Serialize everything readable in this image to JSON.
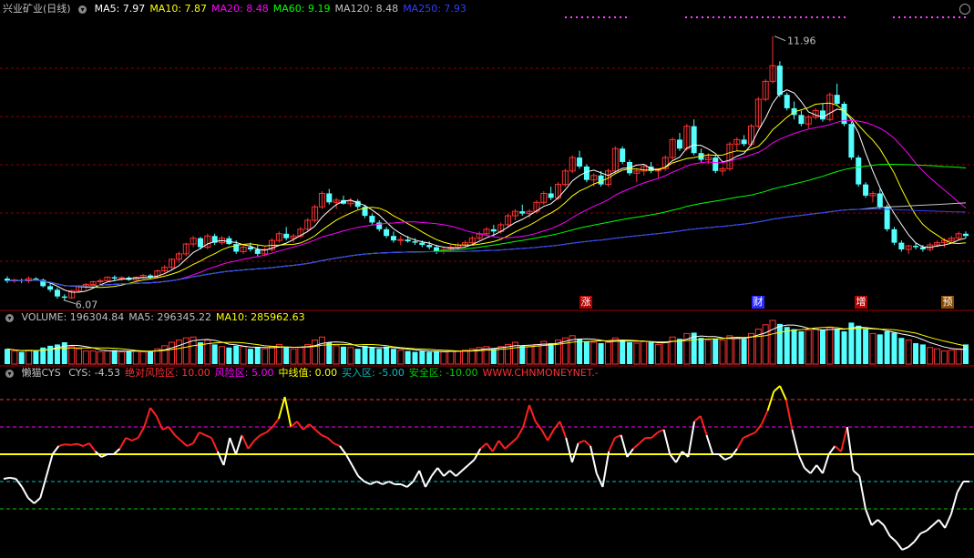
{
  "header": {
    "title": "兴业矿业(日线)",
    "ma_items": [
      {
        "label": "MA5: 7.97",
        "color": "#ffffff"
      },
      {
        "label": "MA10: 7.87",
        "color": "#ffff00"
      },
      {
        "label": "MA20: 8.48",
        "color": "#ff00ff"
      },
      {
        "label": "MA60: 9.19",
        "color": "#00ff00"
      },
      {
        "label": "MA120: 8.48",
        "color": "#c0c0c0"
      },
      {
        "label": "MA250: 7.93",
        "color": "#2f3fff"
      }
    ]
  },
  "volume_header": {
    "items": [
      {
        "label": "VOLUME: 196304.84",
        "color": "#c0c0c0"
      },
      {
        "label": "MA5: 296345.22",
        "color": "#c0c0c0"
      },
      {
        "label": "MA10: 285962.63",
        "color": "#ffff00"
      }
    ]
  },
  "cys_header": {
    "name": "懒猫CYS",
    "items": [
      {
        "label": "CYS: -4.53",
        "color": "#c0c0c0"
      },
      {
        "label": "绝对风险区: 10.00",
        "color": "#ff3030"
      },
      {
        "label": "风险区: 5.00",
        "color": "#ff00ff"
      },
      {
        "label": "中线值: 0.00",
        "color": "#ffff00"
      },
      {
        "label": "买入区: -5.00",
        "color": "#00c0c0"
      },
      {
        "label": "安全区: -10.00",
        "color": "#00cc00"
      },
      {
        "label": "WWW.CHNMONEYNET.-",
        "color": "#ff3030"
      }
    ]
  },
  "annotations": {
    "high_label": "11.96",
    "low_label": "6.07"
  },
  "events": [
    "涨",
    "财",
    "增",
    "预"
  ],
  "colors": {
    "up": "#ff3232",
    "down": "#54ffff",
    "bg": "#000000",
    "grid": "#8b0000"
  },
  "chart_data": [
    {
      "type": "candlestick",
      "title": "兴业矿业(日线)",
      "price_high": 11.96,
      "price_low": 6.07,
      "series_note": "daily OHLC (approximate, read from chart)",
      "candles": [
        [
          6.55,
          6.6,
          6.45,
          6.5
        ],
        [
          6.5,
          6.55,
          6.45,
          6.52
        ],
        [
          6.52,
          6.55,
          6.45,
          6.5
        ],
        [
          6.5,
          6.6,
          6.45,
          6.55
        ],
        [
          6.55,
          6.58,
          6.5,
          6.52
        ],
        [
          6.52,
          6.55,
          6.35,
          6.38
        ],
        [
          6.38,
          6.45,
          6.25,
          6.3
        ],
        [
          6.3,
          6.35,
          6.1,
          6.15
        ],
        [
          6.15,
          6.2,
          6.07,
          6.12
        ],
        [
          6.12,
          6.3,
          6.1,
          6.28
        ],
        [
          6.28,
          6.4,
          6.25,
          6.38
        ],
        [
          6.38,
          6.45,
          6.3,
          6.42
        ],
        [
          6.42,
          6.5,
          6.38,
          6.48
        ],
        [
          6.48,
          6.55,
          6.4,
          6.5
        ],
        [
          6.5,
          6.6,
          6.48,
          6.58
        ],
        [
          6.58,
          6.62,
          6.5,
          6.55
        ],
        [
          6.55,
          6.6,
          6.5,
          6.57
        ],
        [
          6.57,
          6.6,
          6.5,
          6.52
        ],
        [
          6.52,
          6.6,
          6.5,
          6.58
        ],
        [
          6.58,
          6.65,
          6.55,
          6.62
        ],
        [
          6.62,
          6.65,
          6.55,
          6.58
        ],
        [
          6.58,
          6.75,
          6.55,
          6.72
        ],
        [
          6.72,
          6.85,
          6.68,
          6.8
        ],
        [
          6.8,
          7.0,
          6.75,
          6.98
        ],
        [
          6.98,
          7.15,
          6.9,
          7.1
        ],
        [
          7.1,
          7.35,
          7.05,
          7.32
        ],
        [
          7.32,
          7.5,
          7.25,
          7.45
        ],
        [
          7.45,
          7.48,
          7.2,
          7.25
        ],
        [
          7.25,
          7.55,
          7.2,
          7.5
        ],
        [
          7.5,
          7.55,
          7.3,
          7.35
        ],
        [
          7.35,
          7.5,
          7.3,
          7.45
        ],
        [
          7.45,
          7.5,
          7.3,
          7.32
        ],
        [
          7.32,
          7.4,
          7.1,
          7.15
        ],
        [
          7.15,
          7.3,
          7.1,
          7.25
        ],
        [
          7.25,
          7.35,
          7.15,
          7.2
        ],
        [
          7.2,
          7.3,
          7.05,
          7.1
        ],
        [
          7.1,
          7.25,
          7.05,
          7.2
        ],
        [
          7.2,
          7.45,
          7.15,
          7.4
        ],
        [
          7.4,
          7.6,
          7.35,
          7.55
        ],
        [
          7.55,
          7.7,
          7.4,
          7.45
        ],
        [
          7.45,
          7.55,
          7.35,
          7.5
        ],
        [
          7.5,
          7.7,
          7.45,
          7.65
        ],
        [
          7.65,
          7.9,
          7.6,
          7.85
        ],
        [
          7.85,
          8.2,
          7.8,
          8.15
        ],
        [
          8.15,
          8.5,
          8.1,
          8.45
        ],
        [
          8.45,
          8.55,
          8.2,
          8.25
        ],
        [
          8.25,
          8.35,
          8.1,
          8.3
        ],
        [
          8.3,
          8.4,
          8.2,
          8.22
        ],
        [
          8.22,
          8.35,
          8.15,
          8.28
        ],
        [
          8.28,
          8.32,
          8.1,
          8.15
        ],
        [
          8.15,
          8.2,
          7.9,
          7.95
        ],
        [
          7.95,
          8.0,
          7.75,
          7.8
        ],
        [
          7.8,
          7.85,
          7.6,
          7.65
        ],
        [
          7.65,
          7.7,
          7.45,
          7.5
        ],
        [
          7.5,
          7.6,
          7.35,
          7.4
        ],
        [
          7.4,
          7.5,
          7.3,
          7.42
        ],
        [
          7.42,
          7.5,
          7.35,
          7.38
        ],
        [
          7.38,
          7.45,
          7.3,
          7.35
        ],
        [
          7.35,
          7.4,
          7.25,
          7.3
        ],
        [
          7.3,
          7.38,
          7.2,
          7.25
        ],
        [
          7.25,
          7.3,
          7.1,
          7.15
        ],
        [
          7.15,
          7.25,
          7.1,
          7.2
        ],
        [
          7.2,
          7.3,
          7.15,
          7.25
        ],
        [
          7.25,
          7.35,
          7.2,
          7.3
        ],
        [
          7.3,
          7.4,
          7.25,
          7.35
        ],
        [
          7.35,
          7.5,
          7.3,
          7.45
        ],
        [
          7.45,
          7.6,
          7.4,
          7.55
        ],
        [
          7.55,
          7.7,
          7.5,
          7.65
        ],
        [
          7.65,
          7.75,
          7.5,
          7.6
        ],
        [
          7.6,
          7.8,
          7.55,
          7.75
        ],
        [
          7.75,
          8.0,
          7.7,
          7.95
        ],
        [
          7.95,
          8.1,
          7.85,
          8.05
        ],
        [
          8.05,
          8.2,
          7.95,
          8.0
        ],
        [
          8.0,
          8.1,
          7.9,
          8.05
        ],
        [
          8.05,
          8.3,
          8.0,
          8.25
        ],
        [
          8.25,
          8.5,
          8.2,
          8.45
        ],
        [
          8.45,
          8.6,
          8.3,
          8.35
        ],
        [
          8.35,
          8.7,
          8.3,
          8.65
        ],
        [
          8.65,
          9.0,
          8.6,
          8.95
        ],
        [
          8.95,
          9.3,
          8.9,
          9.25
        ],
        [
          9.25,
          9.4,
          9.0,
          9.05
        ],
        [
          9.05,
          9.1,
          8.7,
          8.75
        ],
        [
          8.75,
          8.9,
          8.6,
          8.85
        ],
        [
          8.85,
          8.95,
          8.6,
          8.65
        ],
        [
          8.65,
          9.0,
          8.6,
          8.95
        ],
        [
          8.95,
          9.5,
          8.9,
          9.45
        ],
        [
          9.45,
          9.5,
          9.1,
          9.15
        ],
        [
          9.15,
          9.2,
          8.85,
          8.9
        ],
        [
          8.9,
          9.0,
          8.7,
          8.95
        ],
        [
          8.95,
          9.1,
          8.85,
          9.05
        ],
        [
          9.05,
          9.15,
          8.9,
          8.95
        ],
        [
          8.95,
          9.0,
          8.8,
          9.0
        ],
        [
          9.0,
          9.3,
          8.95,
          9.25
        ],
        [
          9.25,
          9.7,
          9.2,
          9.65
        ],
        [
          9.65,
          9.8,
          9.4,
          9.45
        ],
        [
          9.45,
          10.0,
          9.4,
          9.95
        ],
        [
          9.95,
          10.1,
          9.3,
          9.35
        ],
        [
          9.35,
          9.45,
          9.15,
          9.2
        ],
        [
          9.2,
          9.35,
          9.1,
          9.25
        ],
        [
          9.25,
          9.3,
          8.9,
          8.95
        ],
        [
          8.95,
          9.05,
          8.85,
          9.0
        ],
        [
          9.0,
          9.6,
          8.95,
          9.55
        ],
        [
          9.55,
          9.7,
          9.4,
          9.65
        ],
        [
          9.65,
          9.75,
          9.5,
          9.55
        ],
        [
          9.55,
          10.0,
          9.5,
          9.95
        ],
        [
          9.95,
          10.6,
          9.9,
          10.55
        ],
        [
          10.55,
          11.0,
          10.5,
          10.95
        ],
        [
          10.95,
          11.96,
          10.9,
          11.3
        ],
        [
          11.3,
          11.4,
          10.6,
          10.65
        ],
        [
          10.65,
          10.7,
          10.3,
          10.35
        ],
        [
          10.35,
          10.5,
          10.1,
          10.2
        ],
        [
          10.2,
          10.3,
          9.95,
          10.0
        ],
        [
          10.0,
          10.2,
          9.9,
          10.15
        ],
        [
          10.15,
          10.35,
          10.1,
          10.3
        ],
        [
          10.3,
          10.45,
          10.05,
          10.1
        ],
        [
          10.1,
          10.7,
          10.05,
          10.65
        ],
        [
          10.65,
          10.9,
          10.4,
          10.45
        ],
        [
          10.45,
          10.5,
          9.95,
          10.0
        ],
        [
          10.0,
          10.05,
          9.2,
          9.25
        ],
        [
          9.25,
          9.3,
          8.6,
          8.65
        ],
        [
          8.65,
          8.7,
          8.35,
          8.4
        ],
        [
          8.4,
          8.5,
          8.25,
          8.45
        ],
        [
          8.45,
          8.55,
          8.1,
          8.15
        ],
        [
          8.15,
          8.2,
          7.6,
          7.65
        ],
        [
          7.65,
          7.7,
          7.3,
          7.35
        ],
        [
          7.35,
          7.4,
          7.15,
          7.2
        ],
        [
          7.2,
          7.3,
          7.1,
          7.28
        ],
        [
          7.28,
          7.35,
          7.2,
          7.25
        ],
        [
          7.25,
          7.3,
          7.15,
          7.2
        ],
        [
          7.2,
          7.35,
          7.15,
          7.3
        ],
        [
          7.3,
          7.4,
          7.25,
          7.35
        ],
        [
          7.35,
          7.45,
          7.25,
          7.4
        ],
        [
          7.4,
          7.5,
          7.35,
          7.45
        ],
        [
          7.45,
          7.6,
          7.4,
          7.55
        ],
        [
          7.55,
          7.6,
          7.45,
          7.5
        ]
      ],
      "ma_lines": [
        "MA5",
        "MA10",
        "MA20",
        "MA60",
        "MA120",
        "MA250"
      ],
      "ylim": [
        5.9,
        12.4
      ]
    },
    {
      "type": "bar",
      "title": "VOLUME",
      "values": [
        0.35,
        0.3,
        0.28,
        0.32,
        0.3,
        0.38,
        0.42,
        0.45,
        0.5,
        0.4,
        0.35,
        0.3,
        0.3,
        0.28,
        0.3,
        0.32,
        0.28,
        0.3,
        0.3,
        0.28,
        0.3,
        0.35,
        0.42,
        0.5,
        0.55,
        0.6,
        0.62,
        0.5,
        0.55,
        0.45,
        0.4,
        0.38,
        0.42,
        0.4,
        0.35,
        0.38,
        0.35,
        0.4,
        0.45,
        0.38,
        0.35,
        0.38,
        0.45,
        0.55,
        0.62,
        0.5,
        0.42,
        0.4,
        0.38,
        0.35,
        0.42,
        0.38,
        0.35,
        0.4,
        0.35,
        0.32,
        0.3,
        0.28,
        0.3,
        0.28,
        0.3,
        0.28,
        0.3,
        0.3,
        0.32,
        0.35,
        0.38,
        0.4,
        0.35,
        0.4,
        0.45,
        0.5,
        0.42,
        0.4,
        0.45,
        0.52,
        0.48,
        0.55,
        0.6,
        0.65,
        0.58,
        0.52,
        0.5,
        0.48,
        0.5,
        0.6,
        0.55,
        0.5,
        0.48,
        0.52,
        0.5,
        0.45,
        0.5,
        0.62,
        0.58,
        0.7,
        0.72,
        0.6,
        0.55,
        0.58,
        0.55,
        0.65,
        0.6,
        0.58,
        0.7,
        0.8,
        0.9,
        1.0,
        0.92,
        0.85,
        0.8,
        0.75,
        0.78,
        0.8,
        0.78,
        0.85,
        0.8,
        0.75,
        0.95,
        0.88,
        0.8,
        0.7,
        0.68,
        0.75,
        0.72,
        0.6,
        0.55,
        0.48,
        0.45,
        0.38,
        0.35,
        0.3,
        0.32,
        0.35,
        0.38,
        0.45,
        0.35
      ],
      "series": [
        {
          "name": "MA5"
        },
        {
          "name": "MA10"
        }
      ]
    },
    {
      "type": "line",
      "title": "懒猫CYS",
      "levels": {
        "绝对风险区": 10,
        "风险区": 5,
        "中线值": 0,
        "买入区": -5,
        "安全区": -10
      },
      "values": [
        -4.5,
        -4.3,
        -4.5,
        -6,
        -8,
        -9,
        -8,
        -4,
        0,
        1.5,
        1.8,
        1.7,
        1.9,
        1.5,
        2,
        0.5,
        -0.5,
        0,
        0,
        1,
        3,
        2.5,
        3,
        5,
        8.5,
        7,
        4.5,
        5,
        3.5,
        2.5,
        1.5,
        2,
        4,
        3.5,
        3,
        0.5,
        -2,
        3,
        0,
        3.5,
        1,
        2.5,
        3.5,
        4,
        5,
        6.5,
        10.5,
        5,
        6,
        4.5,
        5.5,
        4.5,
        3.5,
        3,
        2,
        1.5,
        0,
        -2,
        -4,
        -5,
        -5.5,
        -5,
        -5.5,
        -5,
        -5.5,
        -5.5,
        -6,
        -5,
        -3,
        -6,
        -4,
        -2.5,
        -4,
        -3,
        -4,
        -3,
        -2,
        -1,
        1,
        2,
        0.5,
        2.5,
        1,
        2,
        3,
        5,
        9,
        6,
        4.5,
        2.5,
        4.5,
        6,
        3,
        -1.5,
        2,
        2.5,
        1.5,
        -3.5,
        -6,
        0.5,
        3,
        3.5,
        -0.5,
        1,
        2,
        3,
        3,
        4,
        4.5,
        0,
        -1.5,
        0.5,
        -0.5,
        6,
        7,
        3.5,
        0,
        0,
        -1,
        -0.5,
        1,
        3,
        3.5,
        4,
        5.5,
        8,
        11.5,
        12.5,
        10,
        4.5,
        0,
        -2.5,
        -3.5,
        -2,
        -3.5,
        0,
        1.5,
        0.5,
        5,
        -3,
        -4,
        -10,
        -13,
        -12,
        -13,
        -15,
        -16,
        -17.5,
        -17,
        -16,
        -14.5,
        -14,
        -13,
        -12,
        -13.5,
        -11,
        -7,
        -5,
        -5
      ]
    }
  ]
}
